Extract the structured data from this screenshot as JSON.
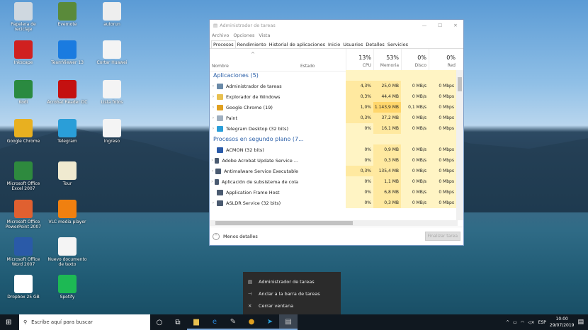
{
  "desktop_icons": [
    {
      "label": "Papelera de reciclaje",
      "color": "#cfd8e0"
    },
    {
      "label": "Evernote",
      "color": "#5a8a3a"
    },
    {
      "label": "autorun",
      "color": "#eeeeee"
    },
    {
      "label": "Inkscape",
      "color": "#d02020"
    },
    {
      "label": "TeamViewer 13",
      "color": "#1a7be0"
    },
    {
      "label": "Cortar Huawei",
      "color": "#f4f4f4"
    },
    {
      "label": "Kodi",
      "color": "#2a8a40"
    },
    {
      "label": "Acrobat Reader DC",
      "color": "#c41010"
    },
    {
      "label": "Lista fotos",
      "color": "#f4f4f4"
    },
    {
      "label": "Google Chrome",
      "color": "#e8b020"
    },
    {
      "label": "Telegram",
      "color": "#2a9ed8"
    },
    {
      "label": "Ingreso",
      "color": "#f4f4f4"
    },
    {
      "label": "Microsoft Office Excel 2007",
      "color": "#2e8a3e"
    },
    {
      "label": "Tour",
      "color": "#f0ead0"
    },
    {
      "label": "Microsoft Office PowerPoint 2007",
      "color": "#e06030"
    },
    {
      "label": "VLC media player",
      "color": "#f08010"
    },
    {
      "label": "Microsoft Office Word 2007",
      "color": "#2a5aa8"
    },
    {
      "label": "Nuevo documento de texto",
      "color": "#f4f4f4"
    },
    {
      "label": "Dropbox 25 GB",
      "color": "#ffffff"
    },
    {
      "label": "Spotify",
      "color": "#1db954"
    }
  ],
  "window": {
    "title": "Administrador de tareas",
    "menu": [
      "Archivo",
      "Opciones",
      "Vista"
    ],
    "tabs": [
      "Procesos",
      "Rendimiento",
      "Historial de aplicaciones",
      "Inicio",
      "Usuarios",
      "Detalles",
      "Servicios"
    ],
    "columns": {
      "name": "Nombre",
      "status": "Estado",
      "cpu": {
        "pct": "13%",
        "label": "CPU"
      },
      "mem": {
        "pct": "53%",
        "label": "Memoria"
      },
      "disk": {
        "pct": "0%",
        "label": "Disco"
      },
      "net": {
        "pct": "0%",
        "label": "Red"
      }
    },
    "groups": [
      {
        "title": "Aplicaciones (5)",
        "rows": [
          {
            "name": "Administrador de tareas",
            "cpu": "4,3%",
            "mem": "25,0 MB",
            "disk": "0 MB/s",
            "net": "0 Mbps",
            "expand": true,
            "icon": "task-manager",
            "color": "#6a8aa8"
          },
          {
            "name": "Explorador de Windows",
            "cpu": "0,3%",
            "mem": "44,4 MB",
            "disk": "0 MB/s",
            "net": "0 Mbps",
            "expand": true,
            "icon": "folder",
            "color": "#e8c050"
          },
          {
            "name": "Google Chrome (19)",
            "cpu": "1,0%",
            "mem": "1.143,9 MB",
            "disk": "0,1 MB/s",
            "net": "0 Mbps",
            "expand": true,
            "icon": "chrome",
            "color": "#e0a020",
            "hot": true
          },
          {
            "name": "Paint",
            "cpu": "0,3%",
            "mem": "37,2 MB",
            "disk": "0 MB/s",
            "net": "0 Mbps",
            "expand": true,
            "icon": "paint",
            "color": "#a0b0c0"
          },
          {
            "name": "Telegram Desktop (32 bits)",
            "cpu": "0%",
            "mem": "16,1 MB",
            "disk": "0 MB/s",
            "net": "0 Mbps",
            "expand": true,
            "icon": "telegram",
            "color": "#2a9ed8"
          }
        ]
      },
      {
        "title": "Procesos en segundo plano (7...",
        "rows": [
          {
            "name": "ACMON (32 bits)",
            "cpu": "0%",
            "mem": "0,9 MB",
            "disk": "0 MB/s",
            "net": "0 Mbps",
            "expand": false,
            "icon": "acmon",
            "color": "#2a5aa8"
          },
          {
            "name": "Adobe Acrobat Update Service ...",
            "cpu": "0%",
            "mem": "0,3 MB",
            "disk": "0 MB/s",
            "net": "0 Mbps",
            "expand": true,
            "icon": "service",
            "color": "#4a5a70"
          },
          {
            "name": "Antimalware Service Executable",
            "cpu": "0,3%",
            "mem": "135,4 MB",
            "disk": "0 MB/s",
            "net": "0 Mbps",
            "expand": true,
            "icon": "service",
            "color": "#4a5a70"
          },
          {
            "name": "Aplicación de subsistema de cola",
            "cpu": "0%",
            "mem": "1,1 MB",
            "disk": "0 MB/s",
            "net": "0 Mbps",
            "expand": true,
            "icon": "printer",
            "color": "#4a5a70"
          },
          {
            "name": "Application Frame Host",
            "cpu": "0%",
            "mem": "6,8 MB",
            "disk": "0 MB/s",
            "net": "0 Mbps",
            "expand": false,
            "icon": "service",
            "color": "#4a5a70"
          },
          {
            "name": "ASLDR Service (32 bits)",
            "cpu": "0%",
            "mem": "0,3 MB",
            "disk": "0 MB/s",
            "net": "0 Mbps",
            "expand": true,
            "icon": "service",
            "color": "#4a5a70"
          }
        ]
      }
    ],
    "less_details": "Menos detalles",
    "end_task": "Finalizar tarea"
  },
  "context_menu": [
    {
      "label": "Administrador de tareas",
      "icon": "task-manager-icon",
      "glyph": "▤"
    },
    {
      "label": "Anclar a la barra de tareas",
      "icon": "pin-icon",
      "glyph": "⊣"
    },
    {
      "label": "Cerrar ventana",
      "icon": "close-icon",
      "glyph": "✕"
    }
  ],
  "taskbar": {
    "search_placeholder": "Escribe aquí para buscar",
    "apps": [
      {
        "name": "cortana",
        "glyph": "○",
        "color": "#fff"
      },
      {
        "name": "task-view",
        "glyph": "⧉",
        "color": "#fff"
      },
      {
        "name": "file-explorer",
        "glyph": "▆",
        "color": "#e8c050"
      },
      {
        "name": "edge",
        "glyph": "e",
        "color": "#2a8ae0"
      },
      {
        "name": "paint",
        "glyph": "✎",
        "color": "#ccc"
      },
      {
        "name": "chrome",
        "glyph": "●",
        "color": "#e0a020"
      },
      {
        "name": "telegram",
        "glyph": "➤",
        "color": "#2a9ed8"
      },
      {
        "name": "task-manager",
        "glyph": "▤",
        "color": "#ccc"
      }
    ],
    "lang": "ESP",
    "time": "10:00",
    "date": "29/07/2019"
  }
}
